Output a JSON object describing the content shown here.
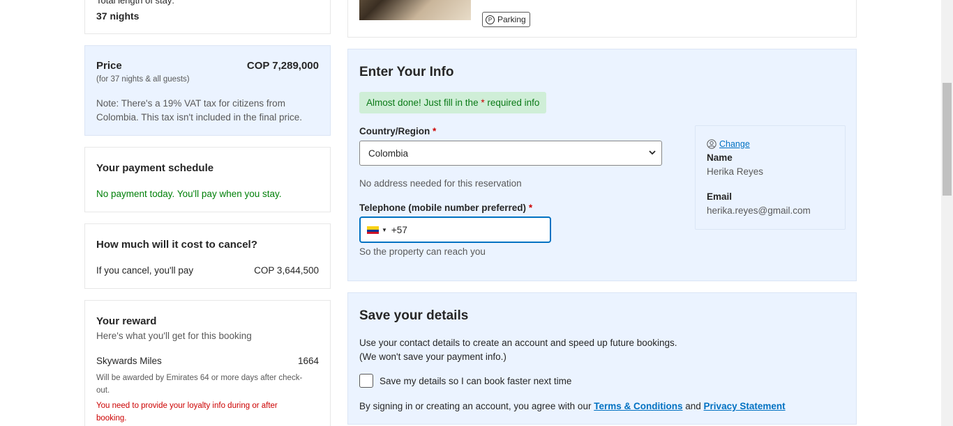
{
  "stay": {
    "label": "Total length of stay:",
    "value": "37 nights"
  },
  "price": {
    "title": "Price",
    "amount": "COP 7,289,000",
    "sub": "(for 37 nights & all guests)",
    "note": "Note: There's a 19% VAT tax for citizens from Colombia. This tax isn't included in the final price."
  },
  "schedule": {
    "title": "Your payment schedule",
    "message": "No payment today. You'll pay when you stay."
  },
  "cancel": {
    "title": "How much will it cost to cancel?",
    "label": "If you cancel, you'll pay",
    "amount": "COP 3,644,500"
  },
  "reward": {
    "title": "Your reward",
    "subtitle": "Here's what you'll get for this booking",
    "program": "Skywards Miles",
    "miles": "1664",
    "note": "Will be awarded by Emirates 64 or more days after check-out.",
    "warning": "You need to provide your loyalty info during or after booking."
  },
  "hotel": {
    "facility": "Parking",
    "facility_icon": "parking-icon"
  },
  "info": {
    "heading": "Enter Your Info",
    "alert_prefix": "Almost done! Just fill in the",
    "alert_star": "*",
    "alert_suffix": "required info",
    "country_label": "Country/Region",
    "required_star": "*",
    "country_value": "Colombia",
    "no_address": "No address needed for this reservation",
    "telephone_label": "Telephone (mobile number preferred)",
    "telephone_value": "+57",
    "telephone_help": "So the property can reach you"
  },
  "user": {
    "change_label": "Change",
    "name_label": "Name",
    "name_value": "Herika Reyes",
    "email_label": "Email",
    "email_value": "herika.reyes@gmail.com"
  },
  "save": {
    "heading": "Save your details",
    "desc_line1": "Use your contact details to create an account and speed up future bookings.",
    "desc_line2": "(We won't save your payment info.)",
    "checkbox_label": "Save my details so I can book faster next time",
    "legal_prefix": "By signing in or creating an account, you agree with our",
    "terms": "Terms & Conditions",
    "and": "and",
    "privacy": "Privacy Statement"
  },
  "colors": {
    "accent": "#0071c2",
    "success": "#008009",
    "error": "#cc0000",
    "info_bg": "#ebf3ff"
  }
}
